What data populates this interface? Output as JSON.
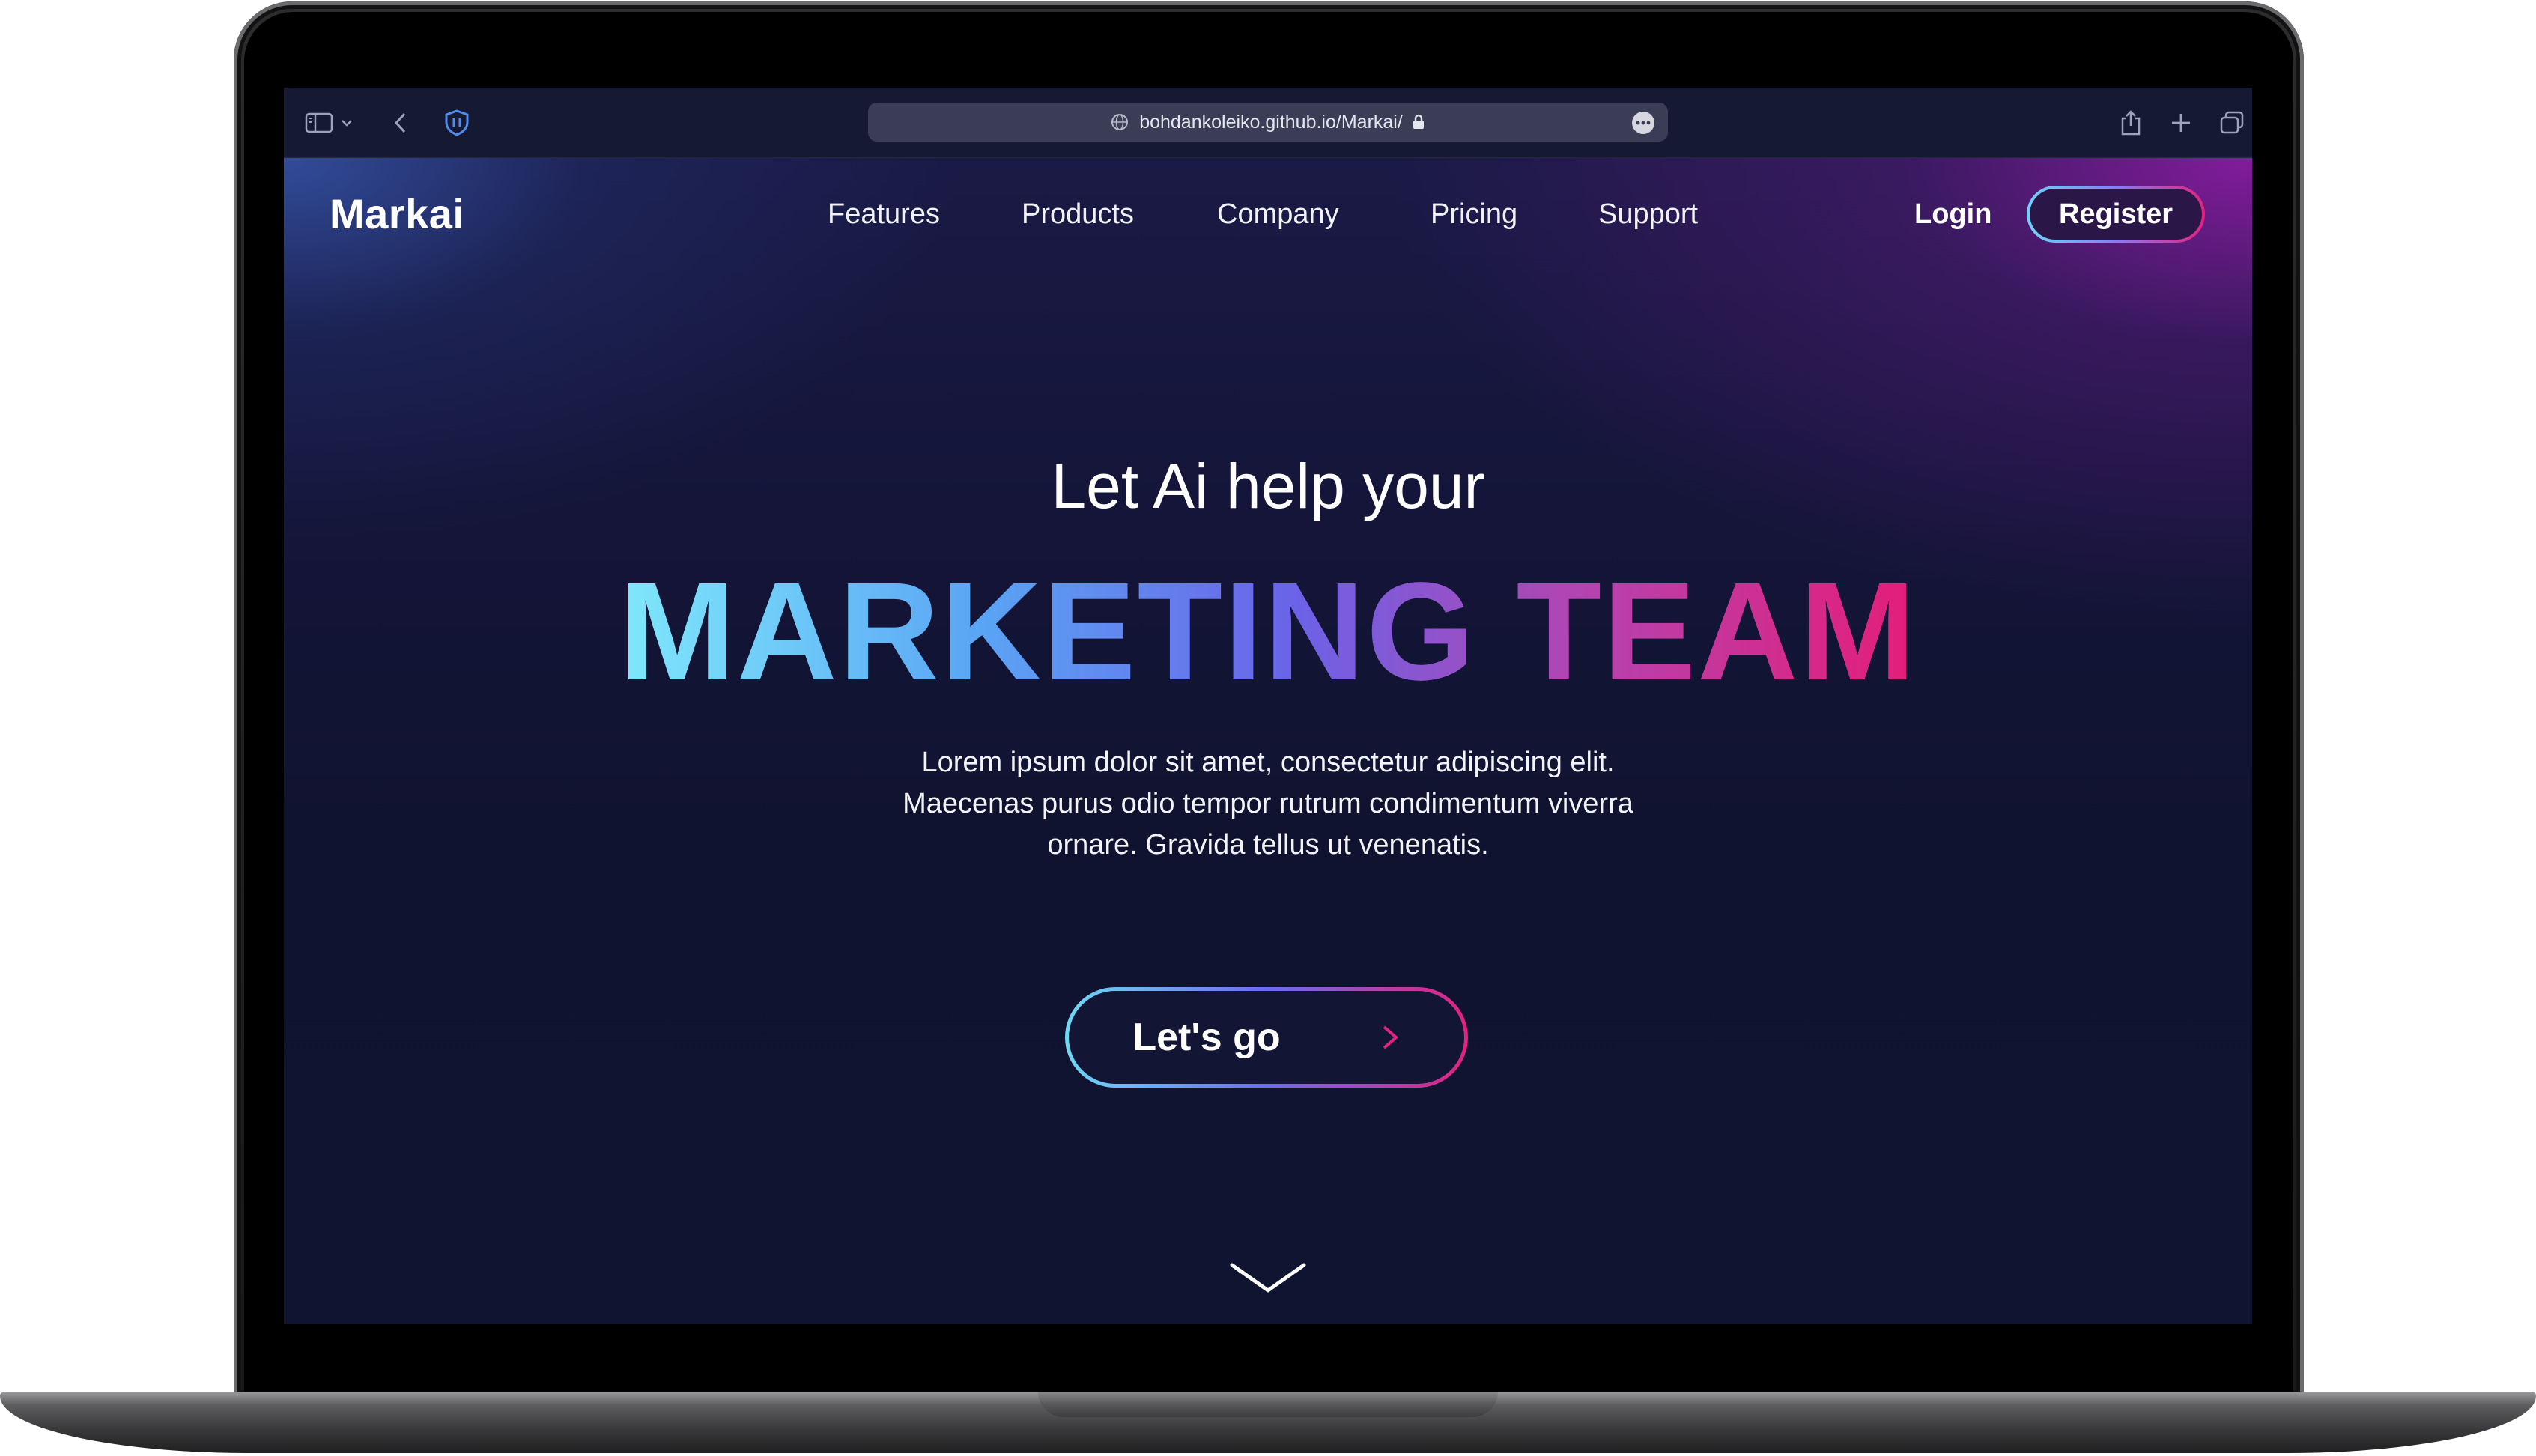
{
  "browser": {
    "url": "bohdankoleiko.github.io/Markai/",
    "icons": [
      "sidebar-icon",
      "chevron-down-icon",
      "back-arrow-icon",
      "shield-icon",
      "globe-icon",
      "lock-icon",
      "more-icon",
      "share-icon",
      "new-tab-icon",
      "tab-overview-icon"
    ]
  },
  "site": {
    "brand": "Markai",
    "nav": [
      "Features",
      "Products",
      "Company",
      "Pricing",
      "Support"
    ],
    "login_label": "Login",
    "register_label": "Register"
  },
  "hero": {
    "subtitle": "Let Ai help your",
    "title": "MARKETING TEAM",
    "description_lines": [
      "Lorem ipsum dolor sit amet, consectetur adipiscing elit.",
      "Maecenas purus odio tempor rutrum condimentum viverra",
      "ornare. Gravida tellus ut venenatis."
    ],
    "cta_label": "Let's go"
  },
  "colors": {
    "gradient_start": "#7fe8fb",
    "gradient_mid": "#6b63e8",
    "gradient_end": "#e41d78",
    "page_background": "#10132f"
  }
}
